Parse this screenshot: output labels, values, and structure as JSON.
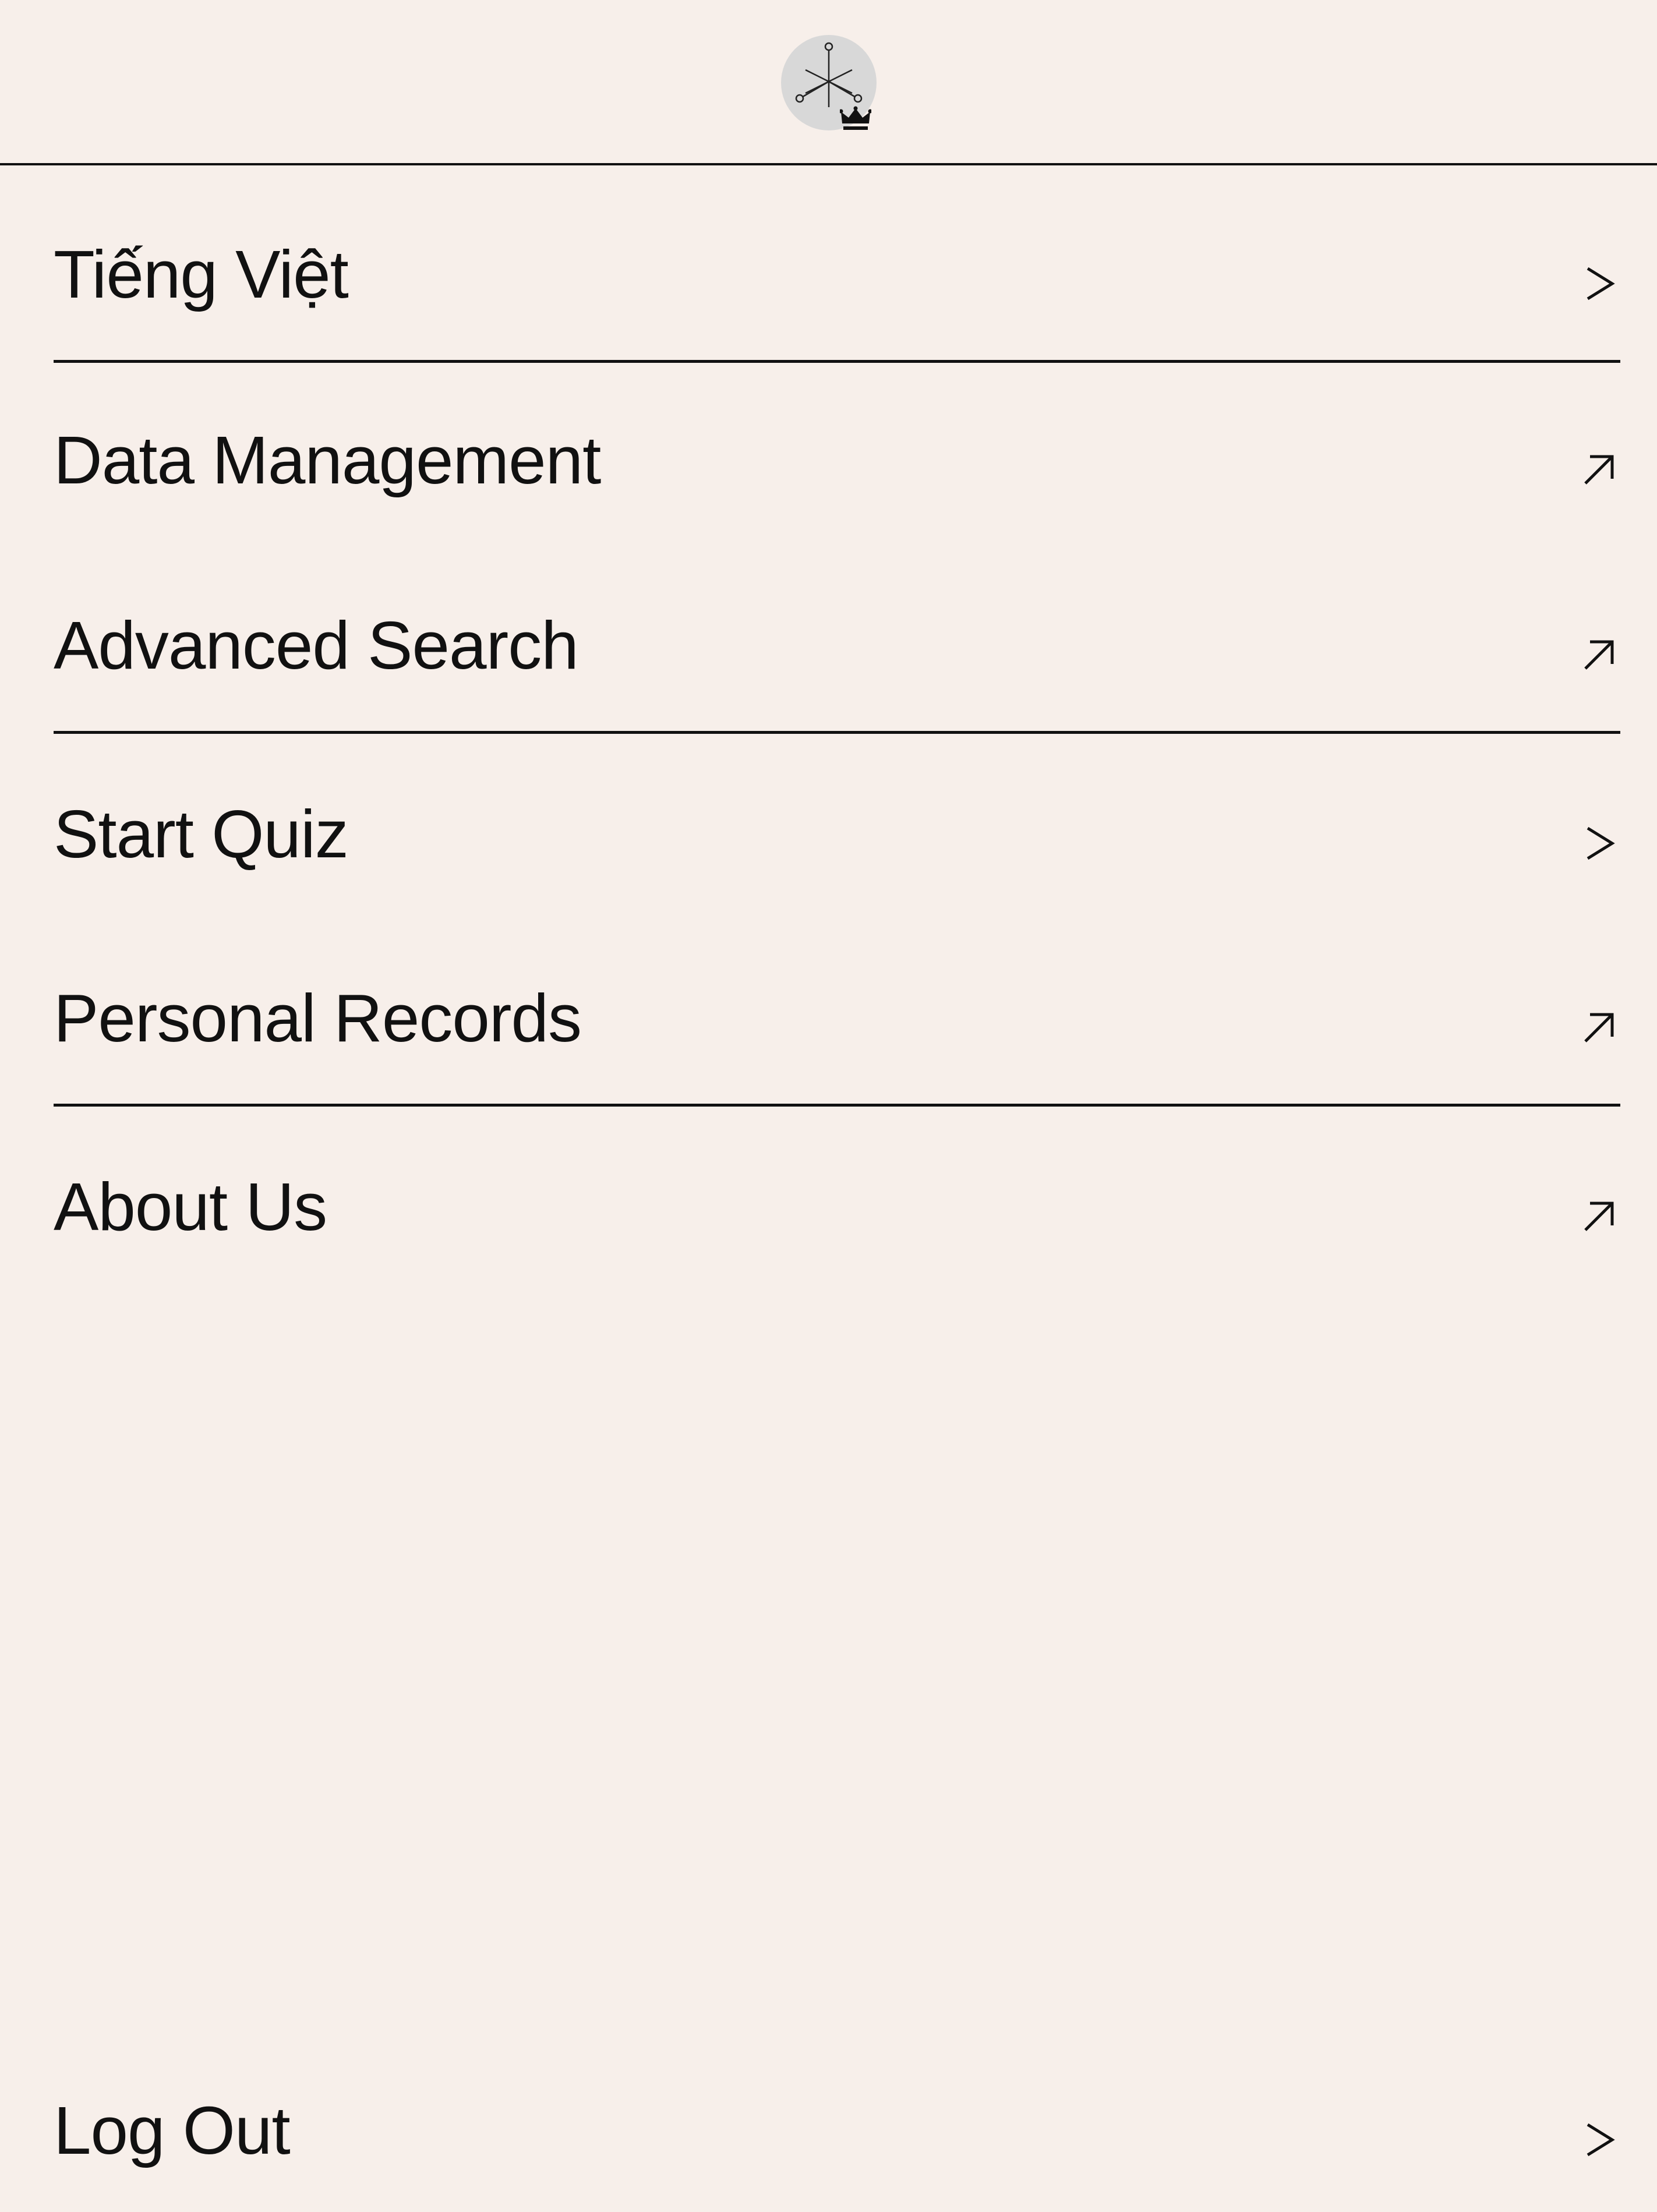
{
  "header": {
    "avatar_icon": "molecule-logo-icon",
    "badge_icon": "crown-icon"
  },
  "menu": [
    {
      "label": "Tiếng Việt",
      "icon": "chevron-right-icon"
    },
    {
      "label": "Data Management",
      "icon": "external-link-arrow-icon"
    },
    {
      "label": "Advanced Search",
      "icon": "external-link-arrow-icon"
    },
    {
      "label": "Start Quiz",
      "icon": "chevron-right-icon"
    },
    {
      "label": "Personal Records",
      "icon": "external-link-arrow-icon"
    },
    {
      "label": "About Us",
      "icon": "external-link-arrow-icon"
    }
  ],
  "footer": {
    "logout_label": "Log Out",
    "logout_icon": "chevron-right-icon"
  },
  "colors": {
    "background": "#f7efea",
    "text": "#111111",
    "avatar_bg": "#d8d8d8"
  }
}
